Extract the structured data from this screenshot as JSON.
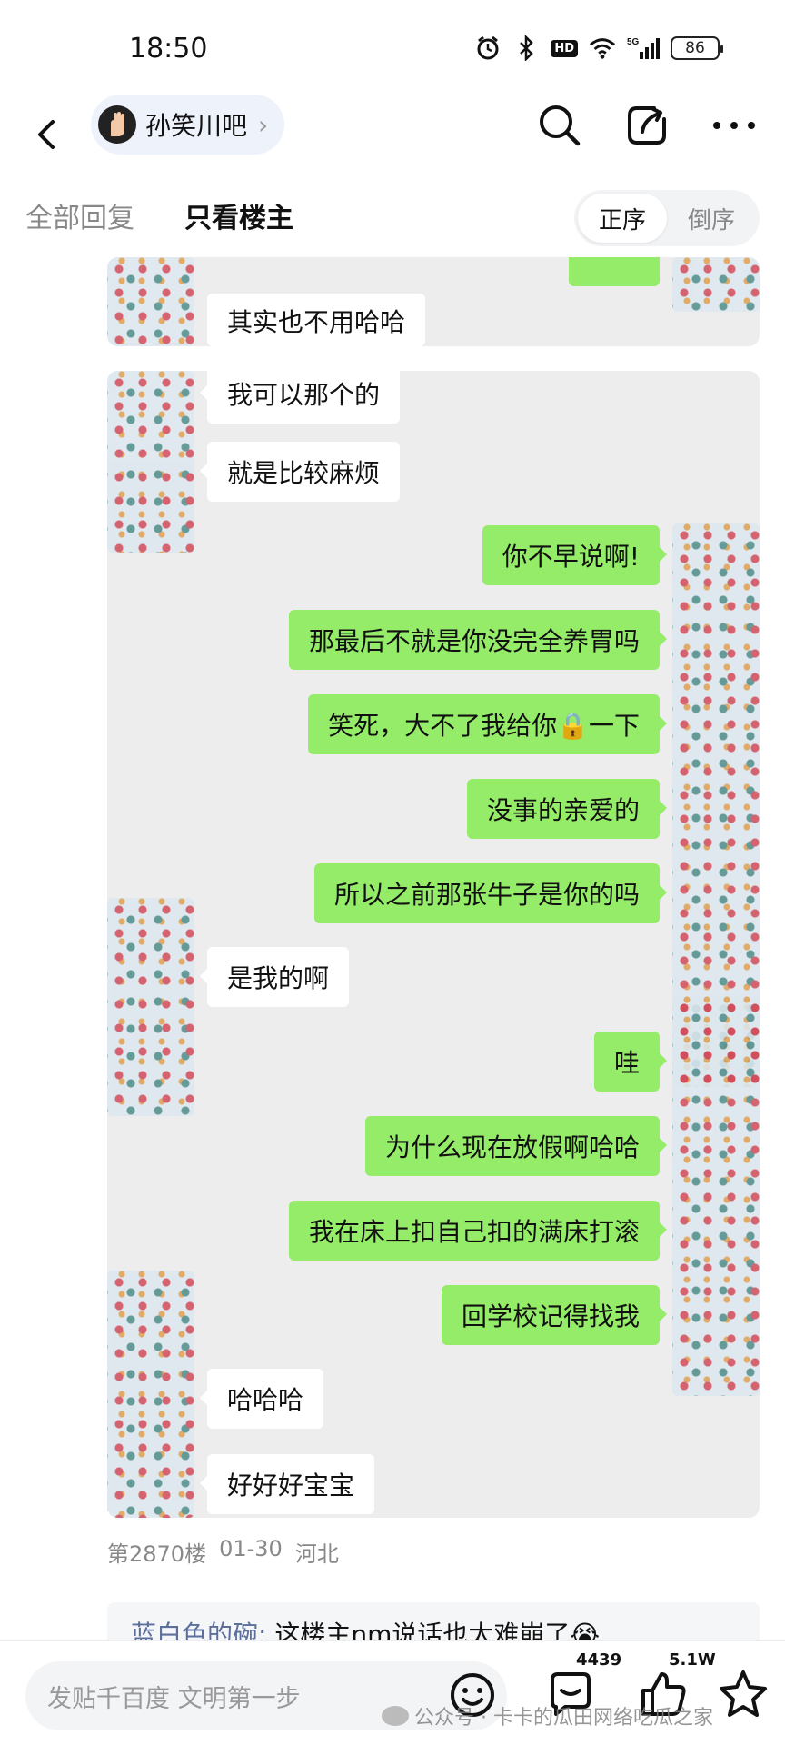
{
  "status_bar": {
    "time": "18:50",
    "hd": "HD",
    "network": "5G",
    "battery": "86"
  },
  "nav": {
    "forum_name": "孙笑川吧",
    "chevron": "›"
  },
  "filter": {
    "tab_all": "全部回复",
    "tab_op": "只看楼主",
    "sort_asc": "正序",
    "sort_desc": "倒序"
  },
  "chat_top": {
    "cut_message": "其实也不用哈哈"
  },
  "chat": {
    "m1": "我可以那个的",
    "m2": "就是比较麻烦",
    "m3": "你不早说啊!",
    "m4": "那最后不就是你没完全养胃吗",
    "m5": "笑死，大不了我给你🔒一下",
    "m6": "没事的亲爱的",
    "m7": "所以之前那张牛子是你的吗",
    "m8": "是我的啊",
    "m9": "哇",
    "m10": "为什么现在放假啊哈哈",
    "m11": "我在床上扣自己扣的满床打滚",
    "m12": "回学校记得找我",
    "m13": "哈哈哈",
    "m14": "好好好宝宝"
  },
  "post_meta": {
    "floor": "第2870楼",
    "date": "01-30",
    "location": "河北"
  },
  "reply_preview": {
    "user": "蓝白色的碗:",
    "text": " 这楼主nm说话也太难崩了😭"
  },
  "bottom_bar": {
    "input_placeholder": "发贴千百度 文明第一步",
    "comment_count": "4439",
    "like_count": "5.1W",
    "watermark": "公众号 · 卡卡的瓜田网络吃瓜之家"
  }
}
